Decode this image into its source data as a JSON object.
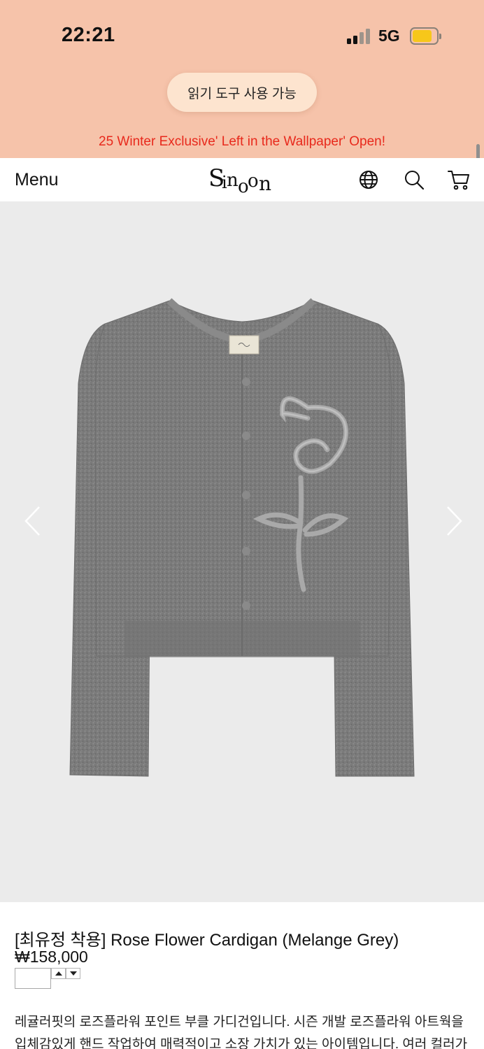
{
  "status_bar": {
    "time": "22:21",
    "network": "5G"
  },
  "reader": {
    "label": "읽기 도구 사용 가능"
  },
  "promo": {
    "text": "25 Winter Exclusive' Left in the Wallpaper' Open!"
  },
  "header": {
    "menu_label": "Menu",
    "logo_text": "Sinoon",
    "icons": [
      "globe-icon",
      "search-icon",
      "cart-icon"
    ]
  },
  "gallery": {
    "prev_icon": "chevron-left-icon",
    "next_icon": "chevron-right-icon"
  },
  "product": {
    "title": "[최유정 착용] Rose Flower Cardigan (Melange Grey)",
    "price": "₩158,000",
    "quantity": "",
    "description_lines": [
      "레귤러핏의 로즈플라워 포인트 부클 가디건입니다. 시즌 개발 로즈플라워 아트웍을",
      "입체감있게 핸드 작업하여 매력적이고 소장 가치가 있는 아이템입니다. 여러 컬러가"
    ]
  },
  "colors": {
    "banner_bg": "#f6c3aa",
    "promo_text": "#e8291c",
    "reader_pill": "#fde4cf",
    "gallery_bg": "#ebebeb",
    "battery": "#f7c71a"
  }
}
